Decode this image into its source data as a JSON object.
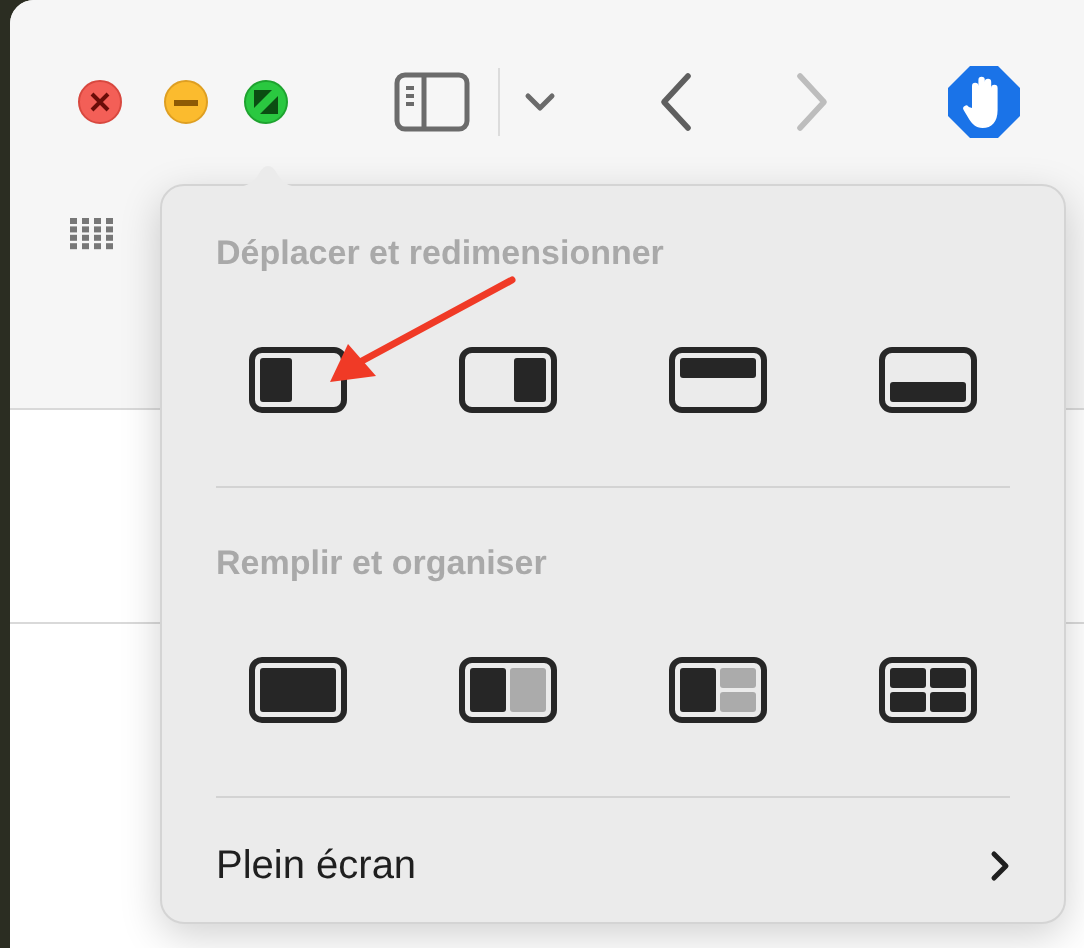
{
  "toolbar": {
    "back": {
      "disabled": false
    },
    "forward": {
      "disabled": true
    }
  },
  "popover": {
    "sections": [
      {
        "heading": "Déplacer et redimensionner",
        "tiles": [
          {
            "kind": "left-half"
          },
          {
            "kind": "right-half"
          },
          {
            "kind": "top-half"
          },
          {
            "kind": "bottom-half"
          }
        ]
      },
      {
        "heading": "Remplir et organiser",
        "tiles": [
          {
            "kind": "full"
          },
          {
            "kind": "halves"
          },
          {
            "kind": "left-and-quarters"
          },
          {
            "kind": "quarters"
          }
        ]
      }
    ],
    "item": {
      "label": "Plein écran",
      "has_submenu": true
    }
  }
}
